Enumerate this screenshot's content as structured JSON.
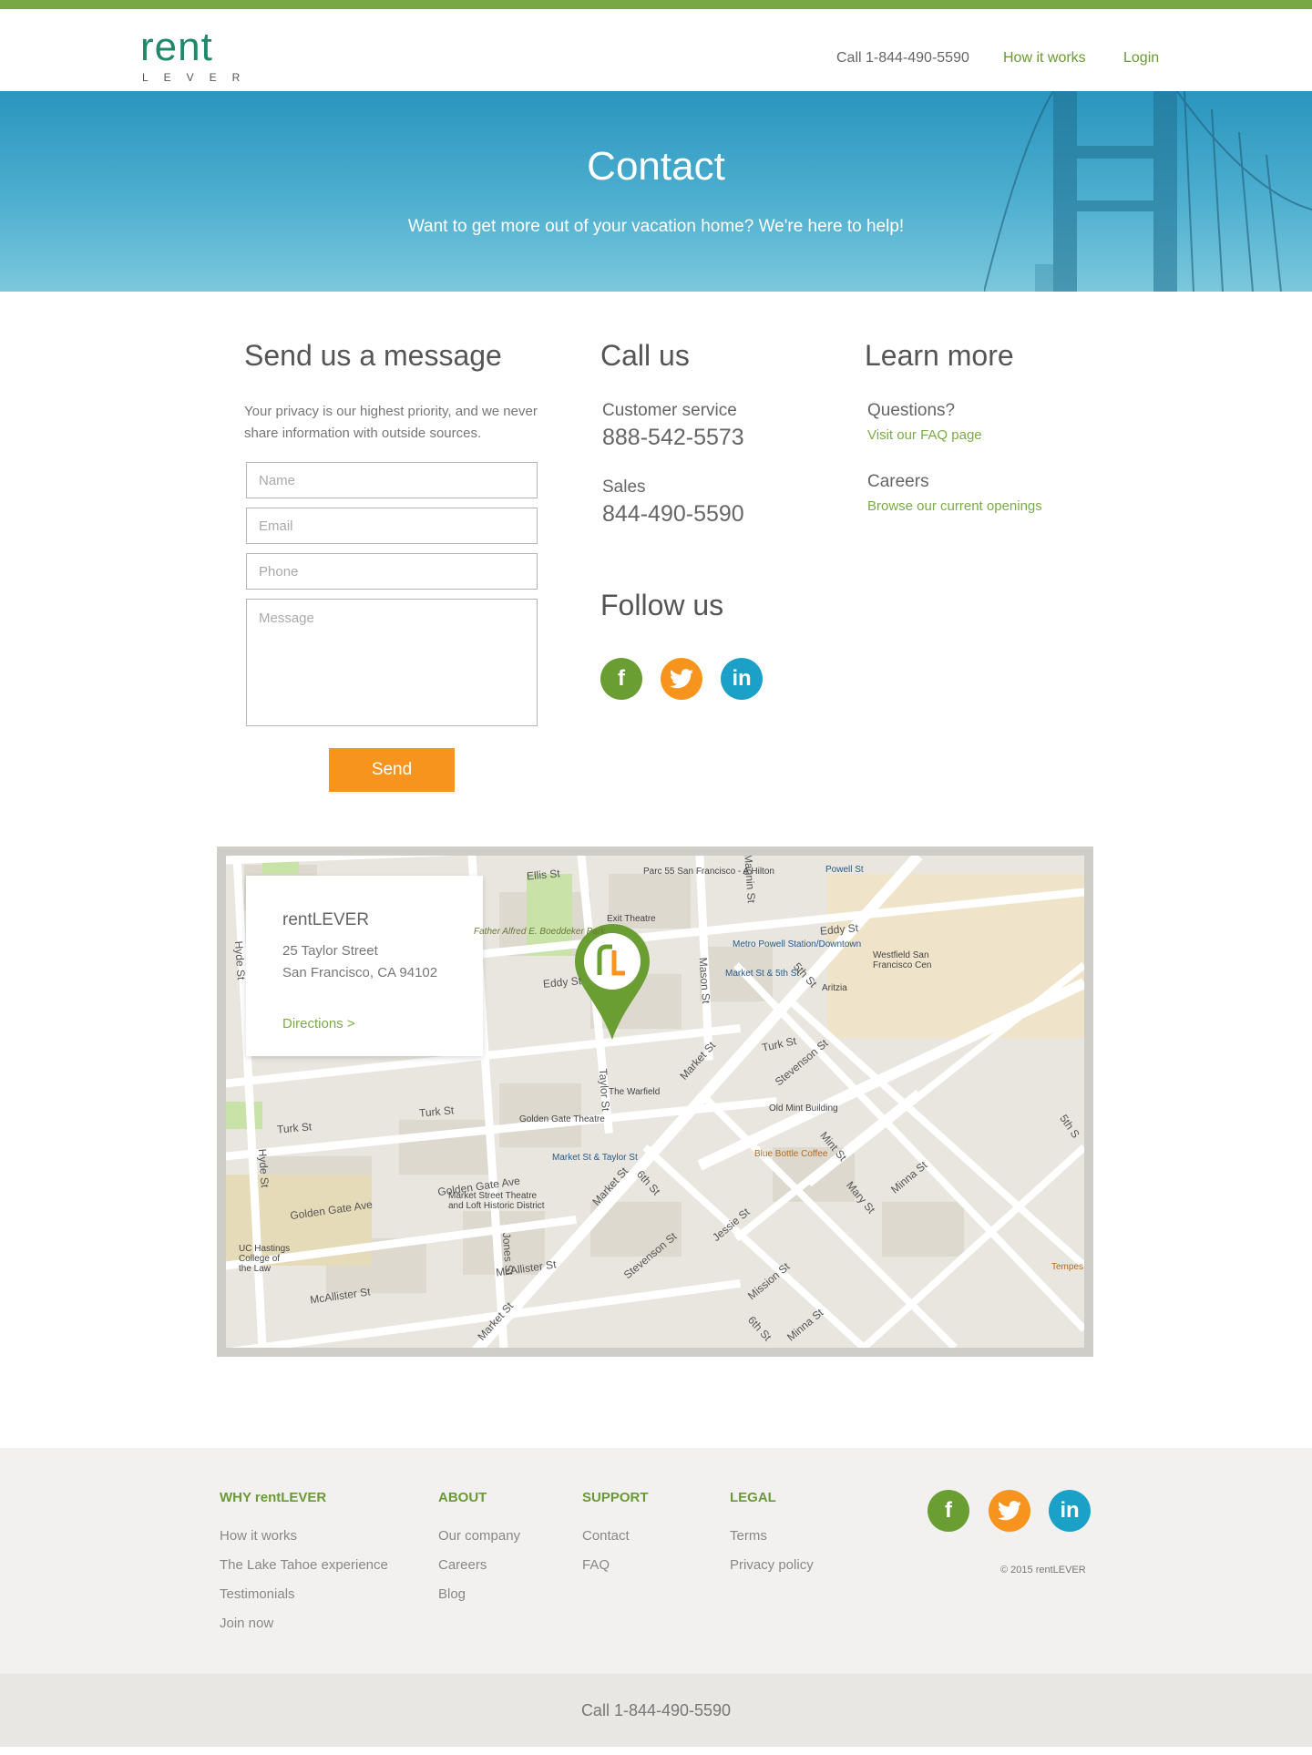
{
  "header": {
    "logo_text": "rent",
    "logo_sub": "LEVER",
    "phone": "Call 1-844-490-5590",
    "nav": [
      {
        "label": "How it works"
      },
      {
        "label": "Login"
      }
    ]
  },
  "hero": {
    "title": "Contact",
    "subtitle": "Want to get more out of your vacation home? We're here to help!"
  },
  "message_form": {
    "heading": "Send us a message",
    "privacy": "Your privacy is our highest priority, and we never share information with outside sources.",
    "name_placeholder": "Name",
    "email_placeholder": "Email",
    "phone_placeholder": "Phone",
    "message_placeholder": "Message",
    "send_label": "Send"
  },
  "call_us": {
    "heading": "Call us",
    "customer_service_label": "Customer service",
    "customer_service_number": "888-542-5573",
    "sales_label": "Sales",
    "sales_number": "844-490-5590"
  },
  "follow_us": {
    "heading": "Follow us",
    "facebook": "f",
    "linkedin": "in"
  },
  "learn_more": {
    "heading": "Learn more",
    "questions_label": "Questions?",
    "faq_link": "Visit our FAQ page",
    "careers_label": "Careers",
    "careers_link": "Browse our current openings"
  },
  "map": {
    "card_title": "rentLEVER",
    "address_line1": "25 Taylor Street",
    "address_line2": "San Francisco, CA 94102",
    "directions": "Directions >",
    "streets": {
      "ellis": "Ellis St",
      "eddy_left": "Eddy St",
      "eddy_right": "Eddy St",
      "turk_left": "Turk St",
      "turk_mid": "Turk St",
      "turk_right": "Turk St",
      "hyde_top": "Hyde St",
      "hyde_bottom": "Hyde St",
      "golden_gate_left": "Golden Gate Ave",
      "golden_gate_mid": "Golden Gate Ave",
      "mcallister_left": "McAllister St",
      "mcallister_mid": "McAllister St",
      "market_top": "Market St",
      "market_mid": "Market St",
      "market_bottom": "Market St",
      "mason": "Mason St",
      "taylor": "Taylor St",
      "jones": "Jones St",
      "fifth": "5th St",
      "fifth_right": "5th S",
      "sixth_top": "6th St",
      "sixth_bottom": "6th St",
      "stevenson_top": "Stevenson St",
      "stevenson_bottom": "Stevenson St",
      "jessie": "Jessie St",
      "mission": "Mission St",
      "mint": "Mint St",
      "mary": "Mary St",
      "minna_right": "Minna St",
      "minna_bottom": "Minna St",
      "magnin": "Magnin St"
    },
    "pois": {
      "parc55": "Parc 55 San Francisco - A Hilton",
      "exit_theatre": "Exit Theatre",
      "park": "Father Alfred E. Boeddeker Park",
      "metro_powell": "Metro Powell Station/Downtown",
      "market_5th": "Market St & 5th St",
      "powell_st": "Powell St",
      "westfield": "Westfield San Francisco Cen",
      "aritzia": "Aritzia",
      "warfield": "The Warfield",
      "golden_gate_theatre": "Golden Gate Theatre",
      "market_taylor": "Market St & Taylor St",
      "old_mint": "Old Mint Building",
      "blue_bottle": "Blue Bottle Coffee",
      "market_street_theatre": "Market Street Theatre and Loft Historic District",
      "uc_hastings": "UC Hastings College of the Law",
      "tempest": "Tempes"
    }
  },
  "footer": {
    "why": {
      "heading": "WHY rentLEVER",
      "items": [
        "How it works",
        "The Lake Tahoe experience",
        "Testimonials",
        "Join now"
      ]
    },
    "about": {
      "heading": "ABOUT",
      "items": [
        "Our company",
        "Careers",
        "Blog"
      ]
    },
    "support": {
      "heading": "SUPPORT",
      "items": [
        "Contact",
        "FAQ"
      ]
    },
    "legal": {
      "heading": "LEGAL",
      "items": [
        "Terms",
        "Privacy policy"
      ]
    },
    "copyright": "© 2015 rentLEVER",
    "bottom_call": "Call 1-844-490-5590"
  },
  "colors": {
    "brand_green": "#78a846",
    "brand_orange": "#f7941d",
    "brand_teal": "#1e8a6a",
    "linkedin_blue": "#1ba1c8"
  }
}
